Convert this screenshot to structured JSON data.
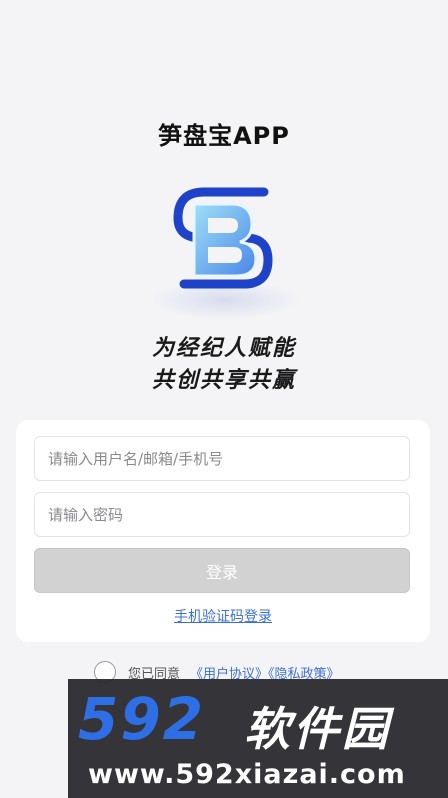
{
  "app": {
    "title": "笋盘宝APP"
  },
  "slogan": {
    "line1": "为经纪人赋能",
    "line2": "共创共享共赢"
  },
  "login": {
    "username_placeholder": "请输入用户名/邮箱/手机号",
    "password_placeholder": "请输入密码",
    "login_button": "登录",
    "sms_login_link": "手机验证码登录"
  },
  "agreement": {
    "prefix": "您已同意",
    "links": "《用户协议》《隐私政策》"
  },
  "watermark": {
    "number": "592",
    "brand": "软件园",
    "url": "www.592xiazai.com"
  },
  "colors": {
    "accent": "#3b6fd6",
    "button_disabled": "#d2d2d2",
    "logo_blue": "#1f43c8",
    "logo_light": "#8fd3f3"
  },
  "icons": {
    "logo": "sb-logo-icon"
  }
}
